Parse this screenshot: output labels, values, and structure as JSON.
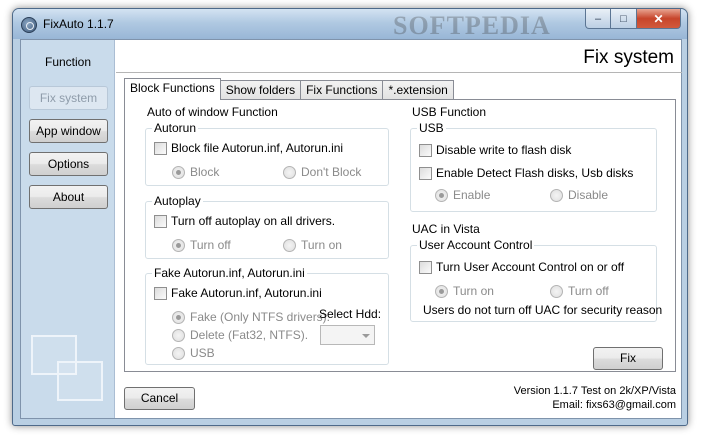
{
  "window": {
    "title": "FixAuto 1.1.7",
    "watermark": "SOFTPEDIA",
    "controls": {
      "minimize": "–",
      "maximize": "□",
      "close": "✕"
    }
  },
  "sidebar": {
    "title": "Function",
    "buttons": [
      {
        "label": "Fix system",
        "state": "disabled"
      },
      {
        "label": "App window"
      },
      {
        "label": "Options"
      },
      {
        "label": "About"
      }
    ]
  },
  "header": {
    "title": "Fix system"
  },
  "tabs": [
    "Block Functions",
    "Show folders",
    "Fix Functions",
    "*.extension"
  ],
  "auto_window": {
    "title": "Auto of window Function",
    "autorun": {
      "label": "Autorun",
      "checkbox": "Block file Autorun.inf, Autorun.ini",
      "radios": [
        "Block",
        "Don't Block"
      ],
      "selected": "Block"
    },
    "autoplay": {
      "label": "Autoplay",
      "checkbox": "Turn off autoplay on all drivers.",
      "radios": [
        "Turn off",
        "Turn on"
      ],
      "selected": "Turn off"
    },
    "fake_autorun": {
      "label": "Fake Autorun.inf, Autorun.ini",
      "checkbox": "Fake Autorun.inf, Autorun.ini",
      "radios": [
        "Fake (Only NTFS drivers).",
        "Delete (Fat32, NTFS).",
        "USB"
      ],
      "selected": "Fake (Only NTFS drivers).",
      "select_label": "Select Hdd:",
      "select_value": ""
    }
  },
  "usb": {
    "title": "USB Function",
    "group_label": "USB",
    "checkboxes": [
      "Disable write to flash disk",
      "Enable Detect Flash disks, Usb disks"
    ],
    "radios": [
      "Enable",
      "Disable"
    ],
    "selected": "Enable"
  },
  "uac": {
    "title": "UAC in Vista",
    "group_label": "User Account Control",
    "checkbox": "Turn User Account Control on or off",
    "radios": [
      "Turn on",
      "Turn off"
    ],
    "selected": "Turn on",
    "note": "Users do not turn off UAC for security reason"
  },
  "actions": {
    "fix": "Fix",
    "cancel": "Cancel"
  },
  "footer": {
    "version": "Version 1.1.7 Test on 2k/XP/Vista",
    "email": "Email: fixs63@gmail.com"
  }
}
